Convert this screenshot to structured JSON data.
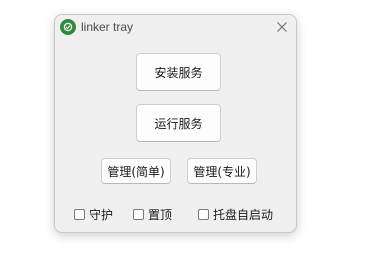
{
  "window": {
    "title": "linker tray"
  },
  "buttons": {
    "install_service": "安装服务",
    "run_service": "运行服务",
    "manage_simple": "管理(简单)",
    "manage_pro": "管理(专业)"
  },
  "checkboxes": [
    {
      "label": "守护",
      "checked": false
    },
    {
      "label": "置顶",
      "checked": false
    },
    {
      "label": "托盘自启动",
      "checked": false
    }
  ],
  "icons": {
    "app": "linker-app-icon",
    "close": "close-icon"
  },
  "colors": {
    "app_icon": "#2e8b3a",
    "window_bg": "#f0f0f0"
  }
}
